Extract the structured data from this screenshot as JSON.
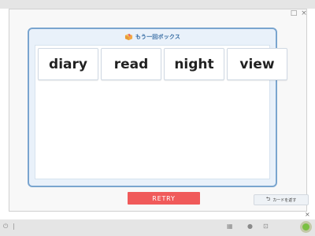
{
  "window": {
    "restore_icon": "□",
    "close_icon": "×"
  },
  "box": {
    "title": "もう一回ボックス",
    "icon": "box-icon"
  },
  "cards": [
    {
      "word": "diary"
    },
    {
      "word": "read"
    },
    {
      "word": "night"
    },
    {
      "word": "view"
    }
  ],
  "actions": {
    "retry_label": "RETRY",
    "return_cards_label": "カードを返す"
  },
  "colors": {
    "accent": "#f05a5a",
    "box_border": "#7aa5cf",
    "box_bg": "#e9f1fa"
  },
  "taskbar": {
    "power_icon": "⏻",
    "separator": "|",
    "grid_icon": "▦",
    "lock_icon": "●",
    "screenshot_icon": "⊡"
  }
}
